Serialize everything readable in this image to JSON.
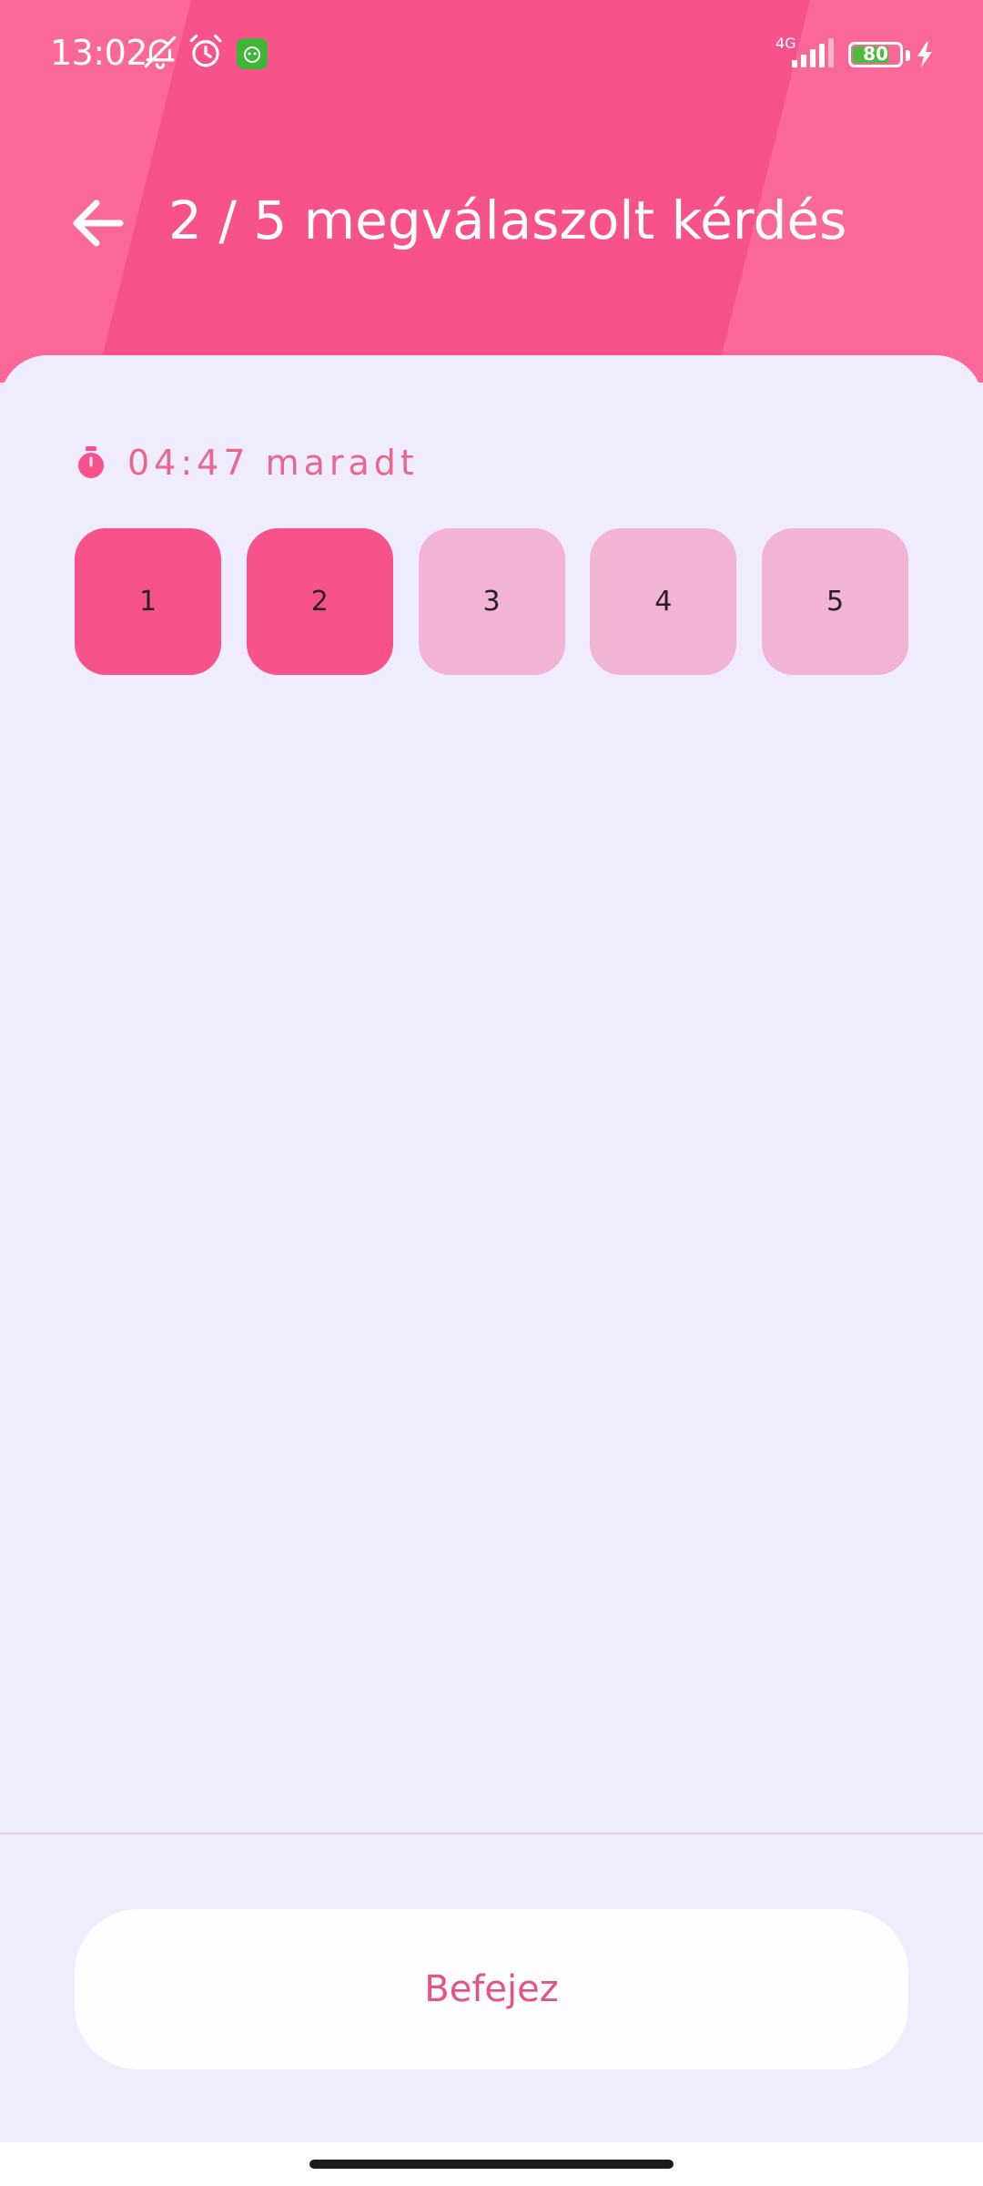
{
  "status_bar": {
    "time": "13:02",
    "network": "4G",
    "battery": "80",
    "battery_level_percent": 80,
    "icons": [
      "bell-muted-icon",
      "alarm-icon",
      "app-badge-icon",
      "signal-icon",
      "battery-icon",
      "charging-icon"
    ]
  },
  "header": {
    "title": "2 / 5 megválaszolt kérdés",
    "back_icon": "arrow-left-icon"
  },
  "timer": {
    "text": "04:47 maradt",
    "icon": "stopwatch-icon"
  },
  "questions": [
    {
      "label": "1",
      "answered": true
    },
    {
      "label": "2",
      "answered": true
    },
    {
      "label": "3",
      "answered": false
    },
    {
      "label": "4",
      "answered": false
    },
    {
      "label": "5",
      "answered": false
    }
  ],
  "finish_button": {
    "label": "Befejez"
  },
  "colors": {
    "header": "#f96897",
    "accent": "#f8528a",
    "unanswered": "#f2b4d5",
    "background": "#efecfe",
    "accent_text": "#e35387"
  }
}
